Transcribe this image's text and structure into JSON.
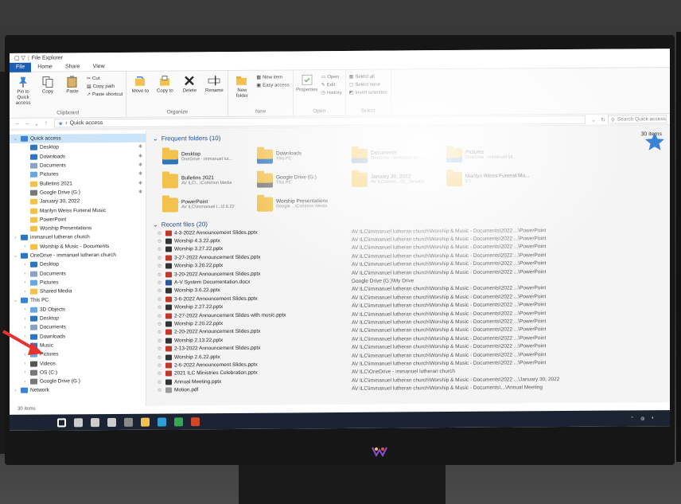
{
  "window": {
    "title": "File Explorer",
    "qa_icons": "▢ ▽"
  },
  "ribbon_tabs": [
    "File",
    "Home",
    "Share",
    "View"
  ],
  "ribbon": {
    "clipboard": {
      "pin_label": "Pin to Quick access",
      "copy": "Copy",
      "paste": "Paste",
      "cut": "Cut",
      "copy_path": "Copy path",
      "paste_shortcut": "Paste shortcut",
      "group": "Clipboard"
    },
    "organize": {
      "move_to": "Move to",
      "copy_to": "Copy to",
      "delete": "Delete",
      "rename": "Rename",
      "group": "Organize"
    },
    "new": {
      "new_folder": "New folder",
      "new_item": "New item",
      "easy_access": "Easy access",
      "group": "New"
    },
    "open": {
      "properties": "Properties",
      "open": "Open",
      "edit": "Edit",
      "history": "History",
      "group": "Open"
    },
    "select": {
      "select_all": "Select all",
      "select_none": "Select none",
      "invert": "Invert selection",
      "group": "Select"
    }
  },
  "address": {
    "path": "Quick access",
    "search_placeholder": "Search Quick access"
  },
  "nav": [
    {
      "label": "Quick access",
      "color": "#3b82d6",
      "selected": true,
      "indent": 0,
      "chev": "⌄"
    },
    {
      "label": "Desktop",
      "color": "#2f74c0",
      "indent": 1,
      "pin": "✱"
    },
    {
      "label": "Downloads",
      "color": "#2f74c0",
      "indent": 1,
      "pin": "✱"
    },
    {
      "label": "Documents",
      "color": "#8aa3c4",
      "indent": 1,
      "pin": "✱"
    },
    {
      "label": "Pictures",
      "color": "#6aa7e0",
      "indent": 1,
      "pin": "✱"
    },
    {
      "label": "Bulletins 2021",
      "color": "#f2c14e",
      "indent": 1,
      "pin": "✱"
    },
    {
      "label": "Google Drive (G:)",
      "color": "#777777",
      "indent": 1,
      "pin": "✱"
    },
    {
      "label": "January 30, 2022",
      "color": "#f2c14e",
      "indent": 1
    },
    {
      "label": "Marilyn Weiss Funeral Music",
      "color": "#f2c14e",
      "indent": 1
    },
    {
      "label": "PowerPoint",
      "color": "#f2c14e",
      "indent": 1
    },
    {
      "label": "Worship Presentations",
      "color": "#f2c14e",
      "indent": 1
    },
    {
      "label": "immanuel lutheran church",
      "color": "#2f74c0",
      "indent": 0,
      "chev": "›"
    },
    {
      "label": "Worship & Music - Documents",
      "color": "#f2c14e",
      "indent": 1,
      "chev": "›"
    },
    {
      "label": "OneDrive - immanuel lutheran church",
      "color": "#2f74c0",
      "indent": 0,
      "chev": "⌄"
    },
    {
      "label": "Desktop",
      "color": "#2f74c0",
      "indent": 1,
      "chev": "›"
    },
    {
      "label": "Documents",
      "color": "#8aa3c4",
      "indent": 1,
      "chev": "›"
    },
    {
      "label": "Pictures",
      "color": "#6aa7e0",
      "indent": 1,
      "chev": "›"
    },
    {
      "label": "Shared Media",
      "color": "#f2c14e",
      "indent": 1,
      "chev": "›"
    },
    {
      "label": "This PC",
      "color": "#3b82d6",
      "indent": 0,
      "chev": "⌄"
    },
    {
      "label": "3D Objects",
      "color": "#6aa7e0",
      "indent": 1,
      "chev": "›"
    },
    {
      "label": "Desktop",
      "color": "#2f74c0",
      "indent": 1,
      "chev": "›"
    },
    {
      "label": "Documents",
      "color": "#8aa3c4",
      "indent": 1,
      "chev": "›"
    },
    {
      "label": "Downloads",
      "color": "#2f74c0",
      "indent": 1,
      "chev": "›"
    },
    {
      "label": "Music",
      "color": "#2f74c0",
      "indent": 1,
      "chev": "›"
    },
    {
      "label": "Pictures",
      "color": "#6aa7e0",
      "indent": 1,
      "chev": "›"
    },
    {
      "label": "Videos",
      "color": "#555555",
      "indent": 1,
      "chev": "›"
    },
    {
      "label": "OS (C:)",
      "color": "#777777",
      "indent": 1,
      "chev": "›"
    },
    {
      "label": "Google Drive (G:)",
      "color": "#777777",
      "indent": 1,
      "chev": "›"
    },
    {
      "label": "Network",
      "color": "#3b82d6",
      "indent": 0,
      "chev": "›"
    }
  ],
  "frequent": {
    "heading": "Frequent folders (10)",
    "count": "30 items",
    "items": [
      {
        "name": "Desktop",
        "sub": "OneDrive - immanuel lut...",
        "color": "#2f74c0"
      },
      {
        "name": "Downloads",
        "sub": "This PC",
        "color": "#2f74c0"
      },
      {
        "name": "Documents",
        "sub": "OneDrive - immanuel lut...",
        "color": "#8aa3c4"
      },
      {
        "name": "Pictures",
        "sub": "OneDrive - immanuel lut...",
        "color": "#6aa7e0"
      },
      {
        "name": "Bulletins 2021",
        "sub": "AV ILC\\...\\Common Media",
        "color": "#f2c14e"
      },
      {
        "name": "Google Drive (G:)",
        "sub": "This PC",
        "color": "#777777"
      },
      {
        "name": "January 30, 2022",
        "sub": "AV ILC\\imma...\\01_January",
        "color": "#f2c14e"
      },
      {
        "name": "Marilyn Weiss Funeral Mu...",
        "sub": "E:\\",
        "color": "#f2c14e"
      },
      {
        "name": "PowerPoint",
        "sub": "AV ILC\\immanuel l...\\2.6.22",
        "color": "#f2c14e"
      },
      {
        "name": "Worship Presentations",
        "sub": "Google ...\\Common Media",
        "color": "#f2c14e"
      }
    ]
  },
  "recent": {
    "heading": "Recent files (20)",
    "items": [
      {
        "name": "4-3-2022 Announcement Slides.pptx",
        "path": "AV ILC\\immanuel lutheran church\\Worship & Music - Documents\\2022 ...\\PowerPoint",
        "color": "#c0392b"
      },
      {
        "name": "Worship 4.3.22.pptx",
        "path": "AV ILC\\immanuel lutheran church\\Worship & Music - Documents\\2022 ...\\PowerPoint",
        "color": "#333333"
      },
      {
        "name": "Worship 3.27.22.pptx",
        "path": "AV ILC\\immanuel lutheran church\\Worship & Music - Documents\\2022 ...\\PowerPoint",
        "color": "#333333"
      },
      {
        "name": "3-27-2022 Announcement Slides.pptx",
        "path": "AV ILC\\immanuel lutheran church\\Worship & Music - Documents\\2022 ...\\PowerPoint",
        "color": "#c0392b"
      },
      {
        "name": "Worship 3.20.22.pptx",
        "path": "AV ILC\\immanuel lutheran church\\Worship & Music - Documents\\2022 ...\\PowerPoint",
        "color": "#333333"
      },
      {
        "name": "3-20-2022 Announcement Slides.pptx",
        "path": "AV ILC\\immanuel lutheran church\\Worship & Music - Documents\\2022 ...\\PowerPoint",
        "color": "#c0392b"
      },
      {
        "name": "A-V System Documentation.docx",
        "path": "Google Drive (G:)\\My Drive",
        "color": "#2b5797"
      },
      {
        "name": "Worship 3.6.22.pptx",
        "path": "AV ILC\\immanuel lutheran church\\Worship & Music - Documents\\2022 ...\\PowerPoint",
        "color": "#333333"
      },
      {
        "name": "3-6-2022 Announcement Slides.pptx",
        "path": "AV ILC\\immanuel lutheran church\\Worship & Music - Documents\\2022 ...\\PowerPoint",
        "color": "#c0392b"
      },
      {
        "name": "Worship 2.27.22.pptx",
        "path": "AV ILC\\immanuel lutheran church\\Worship & Music - Documents\\2022 ...\\PowerPoint",
        "color": "#333333"
      },
      {
        "name": "2-27-2022 Announcement Slides with music.pptx",
        "path": "AV ILC\\immanuel lutheran church\\Worship & Music - Documents\\2022 ...\\PowerPoint",
        "color": "#c0392b"
      },
      {
        "name": "Worship 2.20.22.pptx",
        "path": "AV ILC\\immanuel lutheran church\\Worship & Music - Documents\\2022 ...\\PowerPoint",
        "color": "#333333"
      },
      {
        "name": "2-20-2022 Announcement Slides.pptx",
        "path": "AV ILC\\immanuel lutheran church\\Worship & Music - Documents\\2022 ...\\PowerPoint",
        "color": "#c0392b"
      },
      {
        "name": "Worship 2.13.22.pptx",
        "path": "AV ILC\\immanuel lutheran church\\Worship & Music - Documents\\2022 ...\\PowerPoint",
        "color": "#333333"
      },
      {
        "name": "2-13-2022 Announcement Slides.pptx",
        "path": "AV ILC\\immanuel lutheran church\\Worship & Music - Documents\\2022 ...\\PowerPoint",
        "color": "#c0392b"
      },
      {
        "name": "Worship 2.6.22.pptx",
        "path": "AV ILC\\immanuel lutheran church\\Worship & Music - Documents\\2022 ...\\PowerPoint",
        "color": "#333333"
      },
      {
        "name": "2-6-2022 Announcement Slides.pptx",
        "path": "AV ILC\\immanuel lutheran church\\Worship & Music - Documents\\2022 ...\\PowerPoint",
        "color": "#c0392b"
      },
      {
        "name": "2021 ILC Ministries Celebration.pptx",
        "path": "AV ILC\\OneDrive - immanuel lutheran church",
        "color": "#c0392b"
      },
      {
        "name": "Annual Meeting.pptx",
        "path": "AV ILC\\immanuel lutheran church\\Worship & Music - Documents\\2022 ...\\January 30, 2022",
        "color": "#333333"
      },
      {
        "name": "Motion.pdf",
        "path": "AV ILC\\immanuel lutheran church\\Worship & Music - Documents\\...\\Annual Meeting",
        "color": "#999999"
      }
    ]
  },
  "status": {
    "items": "30 items"
  },
  "taskbar_icons": [
    {
      "name": "start",
      "color": "#ffffff"
    },
    {
      "name": "search",
      "color": "#cccccc"
    },
    {
      "name": "cortana",
      "color": "#cccccc"
    },
    {
      "name": "task-view",
      "color": "#cccccc"
    },
    {
      "name": "dell",
      "color": "#8a8a8a"
    },
    {
      "name": "file-explorer",
      "color": "#f2c14e"
    },
    {
      "name": "edge",
      "color": "#2f9fd8"
    },
    {
      "name": "chrome",
      "color": "#34a853"
    },
    {
      "name": "powerpoint",
      "color": "#d24726"
    }
  ],
  "colors": {
    "accent": "#1a5fb4",
    "selection": "#cce4f7"
  }
}
